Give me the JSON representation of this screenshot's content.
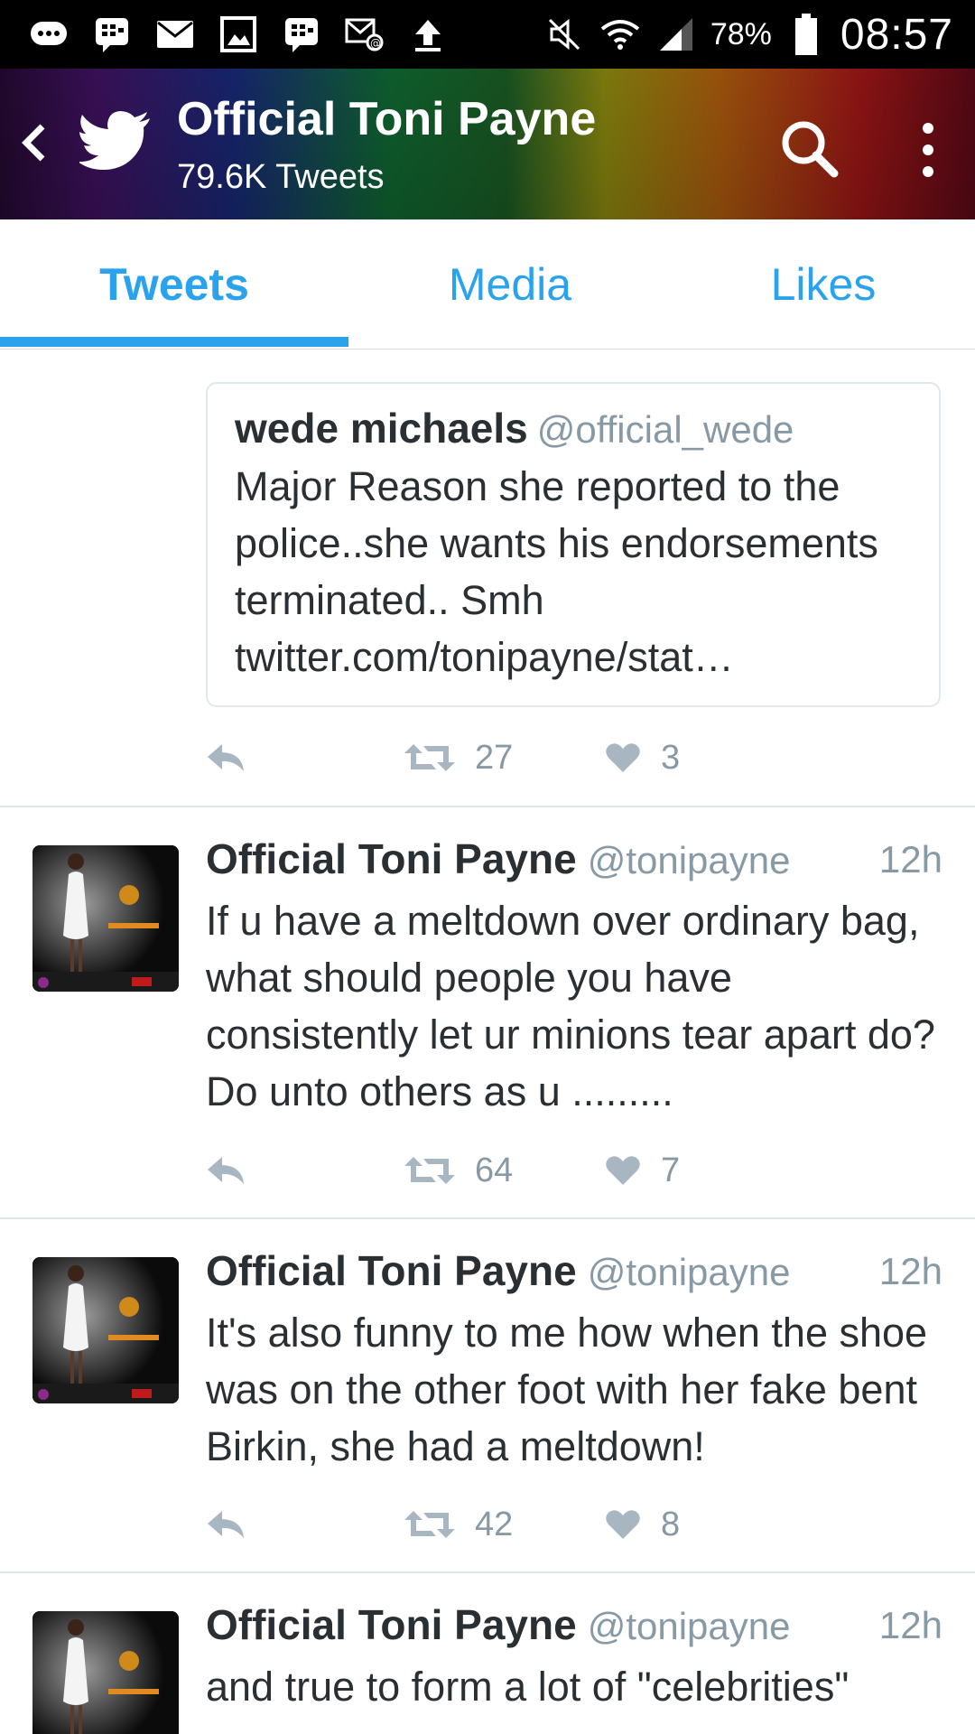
{
  "status_bar": {
    "icons": [
      "chat-bubble-icon",
      "bbm-icon",
      "mail-icon",
      "gallery-icon",
      "bbm-icon",
      "email-icon",
      "upload-icon",
      "mute-icon",
      "wifi-icon",
      "signal-icon"
    ],
    "battery": "78%",
    "time": "08:57"
  },
  "header": {
    "title": "Official Toni Payne",
    "subtitle": "79.6K Tweets"
  },
  "tabs": [
    {
      "label": "Tweets",
      "active": true
    },
    {
      "label": "Media",
      "active": false
    },
    {
      "label": "Likes",
      "active": false
    }
  ],
  "quoted_tweet": {
    "name": "wede michaels",
    "handle": "@official_wede",
    "text": "Major Reason she reported to the police..she wants his endorsements terminated.. Smh twitter.com/tonipayne/stat…",
    "retweets": "27",
    "likes": "3"
  },
  "tweets": [
    {
      "name": "Official Toni Payne",
      "handle": "@tonipayne",
      "time": "12h",
      "text": "If u have a meltdown over ordinary bag, what should people you have consistently let ur minions tear apart do? Do unto others as u .........",
      "retweets": "64",
      "likes": "7"
    },
    {
      "name": "Official Toni Payne",
      "handle": "@tonipayne",
      "time": "12h",
      "text": "It's also funny to me how when the shoe was on the other foot with her fake bent Birkin, she had a meltdown!",
      "retweets": "42",
      "likes": "8"
    },
    {
      "name": "Official Toni Payne",
      "handle": "@tonipayne",
      "time": "12h",
      "text": "and true to form a lot of \"celebrities\""
    }
  ],
  "colors": {
    "accent": "#2aa3ef",
    "text": "#292f33",
    "muted": "#8899a6",
    "divider": "#e1e8ed"
  }
}
